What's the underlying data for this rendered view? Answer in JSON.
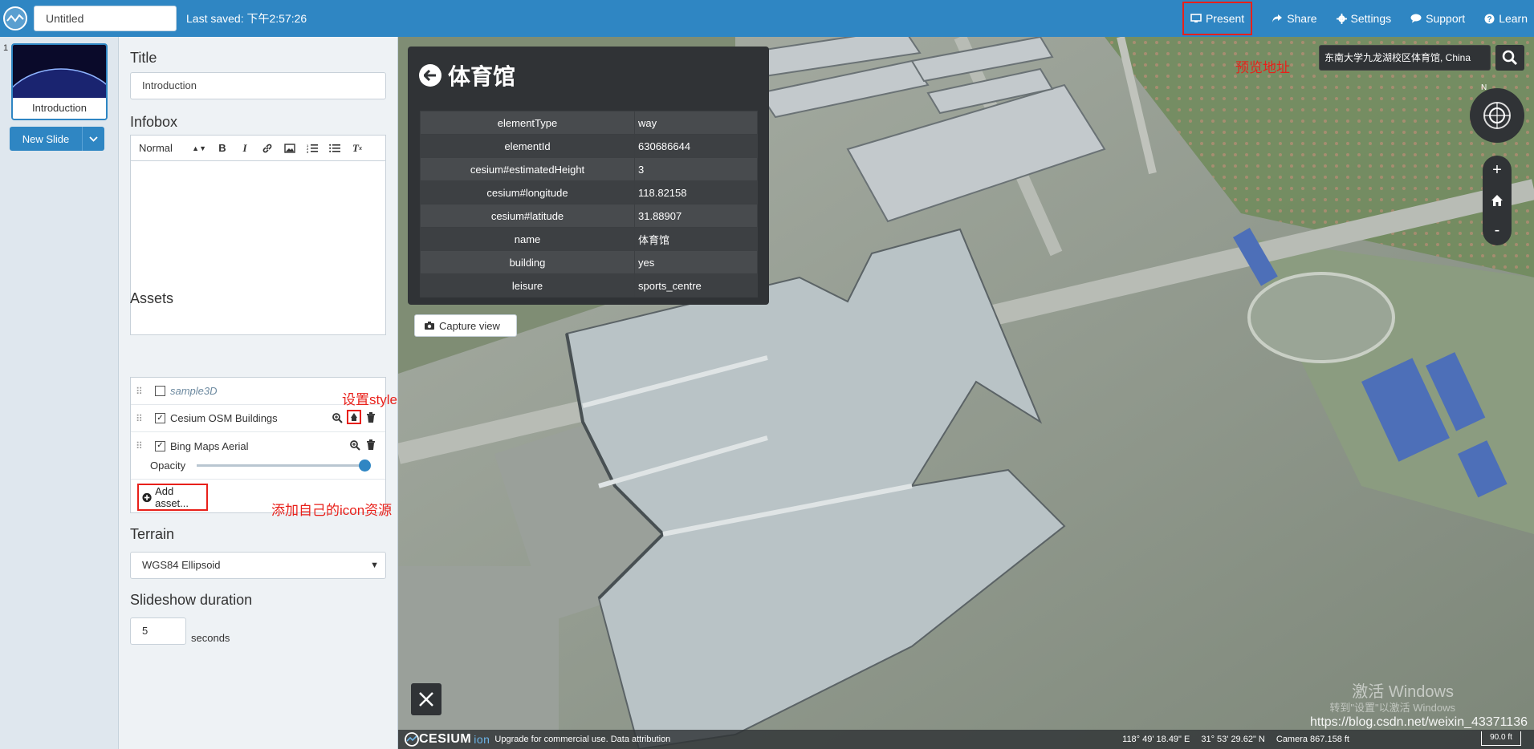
{
  "topbar": {
    "doc_title": "Untitled",
    "last_saved": "Last saved: 下午2:57:26",
    "nav": {
      "present": "Present",
      "share": "Share",
      "settings": "Settings",
      "support": "Support",
      "learn": "Learn"
    }
  },
  "slides": {
    "items": [
      {
        "number": "1",
        "label": "Introduction"
      }
    ],
    "new_slide": "New Slide"
  },
  "editor": {
    "title_heading": "Title",
    "title_value": "Introduction",
    "infobox_heading": "Infobox",
    "toolbar": {
      "format": "Normal",
      "icons": [
        "bold-icon",
        "italic-icon",
        "link-icon",
        "image-icon",
        "ordered-list-icon",
        "bullet-list-icon",
        "clear-format-icon"
      ]
    },
    "assets_heading": "Assets",
    "assets": [
      {
        "name": "sample3D",
        "checked": false
      },
      {
        "name": "Cesium OSM Buildings",
        "checked": true
      },
      {
        "name": "Bing Maps Aerial",
        "checked": true
      }
    ],
    "opacity_label": "Opacity",
    "opacity_value": 1.0,
    "add_asset": "Add asset...",
    "terrain_heading": "Terrain",
    "terrain_value": "WGS84 Ellipsoid",
    "duration_heading": "Slideshow duration",
    "duration_value": "5",
    "duration_unit": "seconds"
  },
  "annotations": {
    "preview": "预览地址",
    "style": "设置style",
    "icon": "添加自己的icon资源"
  },
  "infobox": {
    "title": "体育馆",
    "rows": [
      {
        "key": "elementType",
        "value": "way"
      },
      {
        "key": "elementId",
        "value": "630686644"
      },
      {
        "key": "cesium#estimatedHeight",
        "value": "3"
      },
      {
        "key": "cesium#longitude",
        "value": "118.82158"
      },
      {
        "key": "cesium#latitude",
        "value": "31.88907"
      },
      {
        "key": "name",
        "value": "体育馆"
      },
      {
        "key": "building",
        "value": "yes"
      },
      {
        "key": "leisure",
        "value": "sports_centre"
      }
    ],
    "capture": "Capture view"
  },
  "map": {
    "search_value": "东南大学九龙湖校区体育馆, China",
    "compass_label": "N",
    "zoom_in": "+",
    "zoom_out": "-",
    "brand": "CESIUM",
    "brand_suffix": "ion",
    "credit": "Upgrade for commercial use.  Data attribution",
    "lon": "118° 49' 18.49\" E",
    "lat": "31° 53' 29.62\" N",
    "camera": "Camera 867.158 ft",
    "scale": "90.0 ft",
    "windows_watermark": "激活 Windows",
    "windows_watermark_sub": "转到\"设置\"以激活 Windows",
    "watermark_url": "https://blog.csdn.net/weixin_43371136"
  },
  "colors": {
    "accent": "#2f86c3",
    "annotation": "#e8201a",
    "panel_dark": "#303336"
  }
}
